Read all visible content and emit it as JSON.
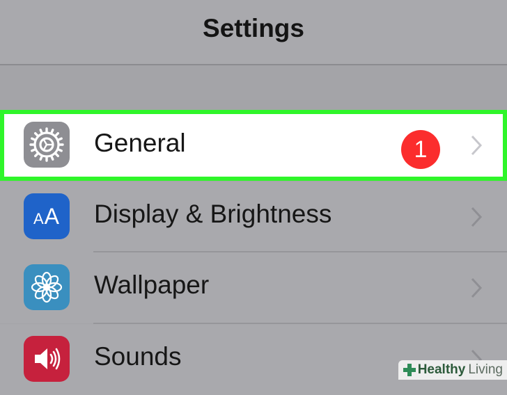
{
  "navbar": {
    "title": "Settings"
  },
  "settings_rows": [
    {
      "label": "General",
      "icon": "gear-icon",
      "icon_bg": "#8e8e93",
      "badge": "1",
      "highlighted": true
    },
    {
      "label": "Display & Brightness",
      "icon": "text-size-icon",
      "icon_text": "AA",
      "icon_bg": "#1f63c9"
    },
    {
      "label": "Wallpaper",
      "icon": "flower-icon",
      "icon_bg": "#3a8fbf"
    },
    {
      "label": "Sounds",
      "icon": "speaker-icon",
      "icon_bg": "#c6213d"
    }
  ],
  "colors": {
    "highlight_outline": "#2ff52a",
    "badge": "#fb2d2d"
  },
  "watermark": {
    "brand": "Healthy",
    "suffix": "Living"
  }
}
